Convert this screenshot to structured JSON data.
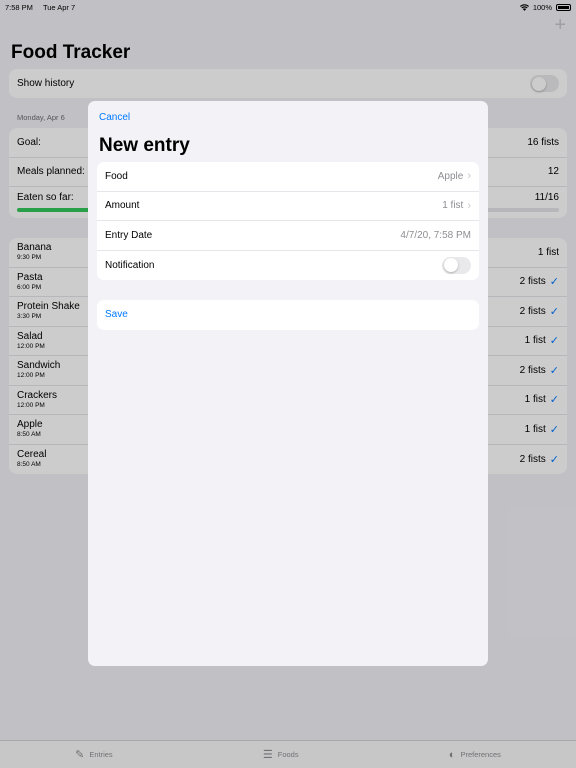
{
  "status_bar": {
    "time": "7:58 PM",
    "date": "Tue Apr 7",
    "battery": "100%"
  },
  "app": {
    "title": "Food Tracker",
    "show_history_label": "Show history",
    "section_header": "Monday, Apr 6",
    "goal": {
      "label": "Goal:",
      "value": "16 fists"
    },
    "meals_planned": {
      "label": "Meals planned:",
      "value": "12"
    },
    "eaten": {
      "label": "Eaten so far:",
      "value": "11/16",
      "progress": 0.6875
    },
    "entries": [
      {
        "name": "Banana",
        "time": "9:30 PM",
        "amount": "1 fist",
        "checked": false
      },
      {
        "name": "Pasta",
        "time": "6:00 PM",
        "amount": "2 fists",
        "checked": true
      },
      {
        "name": "Protein Shake",
        "time": "3:30 PM",
        "amount": "2 fists",
        "checked": true
      },
      {
        "name": "Salad",
        "time": "12:00 PM",
        "amount": "1 fist",
        "checked": true
      },
      {
        "name": "Sandwich",
        "time": "12:00 PM",
        "amount": "2 fists",
        "checked": true
      },
      {
        "name": "Crackers",
        "time": "12:00 PM",
        "amount": "1 fist",
        "checked": true
      },
      {
        "name": "Apple",
        "time": "8:50 AM",
        "amount": "1 fist",
        "checked": true
      },
      {
        "name": "Cereal",
        "time": "8:50 AM",
        "amount": "2 fists",
        "checked": true
      }
    ]
  },
  "tabs": [
    {
      "label": "Entries",
      "icon": "square-pencil-icon"
    },
    {
      "label": "Foods",
      "icon": "list-icon"
    },
    {
      "label": "Preferences",
      "icon": "gauge-icon"
    }
  ],
  "modal": {
    "cancel_label": "Cancel",
    "title": "New entry",
    "food": {
      "label": "Food",
      "value": "Apple"
    },
    "amount": {
      "label": "Amount",
      "value": "1 fist"
    },
    "entry_date": {
      "label": "Entry Date",
      "value": "4/7/20, 7:58 PM"
    },
    "notification": {
      "label": "Notification"
    },
    "save_label": "Save"
  },
  "colors": {
    "accent": "#007aff",
    "progress": "#34c759"
  }
}
